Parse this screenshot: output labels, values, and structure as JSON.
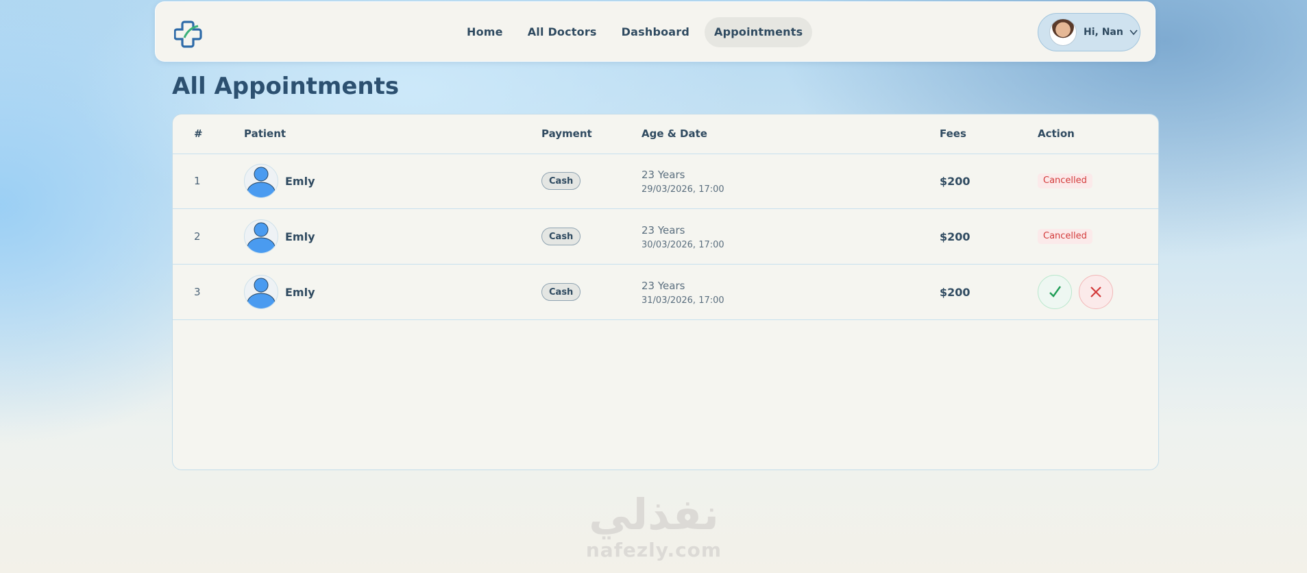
{
  "nav": {
    "links": [
      {
        "label": "Home",
        "active": false
      },
      {
        "label": "All Doctors",
        "active": false
      },
      {
        "label": "Dashboard",
        "active": false
      },
      {
        "label": "Appointments",
        "active": true
      }
    ],
    "user_greeting": "Hi, Nan"
  },
  "page": {
    "title": "All Appointments"
  },
  "table": {
    "headers": [
      "#",
      "Patient",
      "Payment",
      "Age & Date",
      "Fees",
      "Action"
    ],
    "rows": [
      {
        "index": "1",
        "patient": "Emly",
        "payment": "Cash",
        "age": "23 Years",
        "date": "29/03/2026, 17:00",
        "fee": "$200",
        "status": "Cancelled"
      },
      {
        "index": "2",
        "patient": "Emly",
        "payment": "Cash",
        "age": "23 Years",
        "date": "30/03/2026, 17:00",
        "fee": "$200",
        "status": "Cancelled"
      },
      {
        "index": "3",
        "patient": "Emly",
        "payment": "Cash",
        "age": "23 Years",
        "date": "31/03/2026, 17:00",
        "fee": "$200",
        "status": "",
        "actions": [
          "check-icon",
          "close-icon"
        ]
      }
    ]
  },
  "watermark": {
    "arabic": "نفذلي",
    "latin": "nafezly.com"
  },
  "colors": {
    "primary": "#2c5070",
    "accent": "#4a9bf0",
    "cancel": "#d33a3a",
    "confirm": "#1f9d56"
  }
}
